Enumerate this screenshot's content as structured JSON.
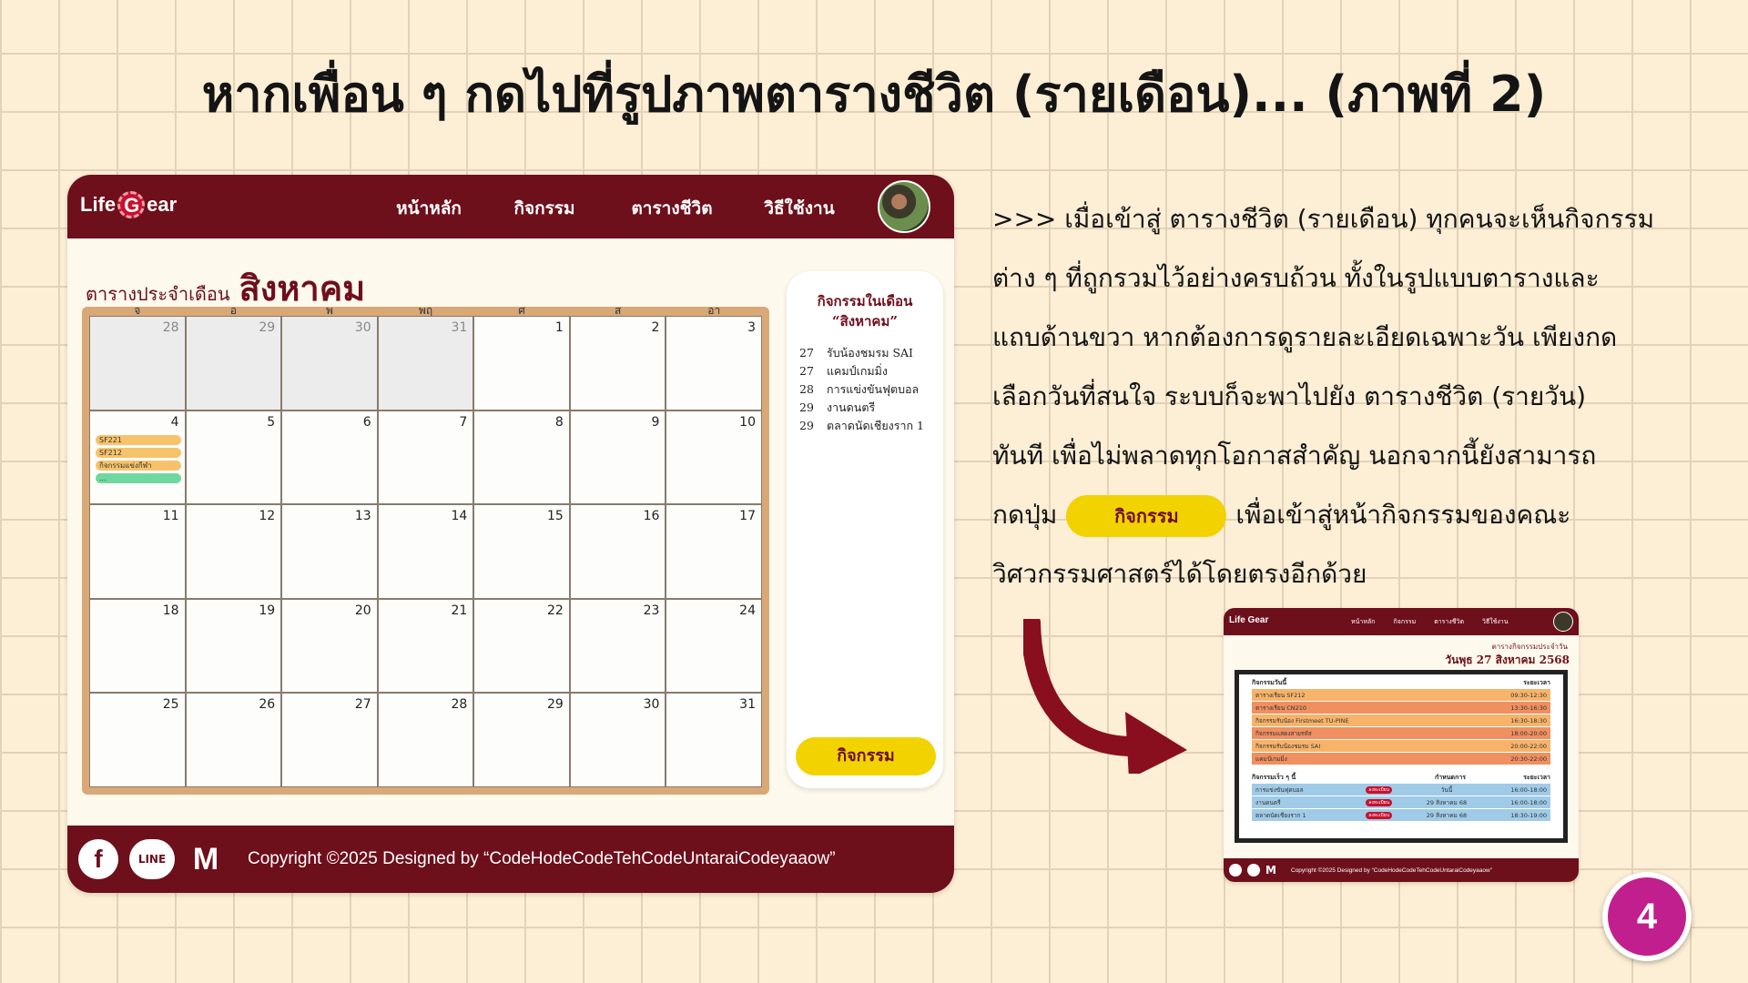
{
  "slide": {
    "title": "หากเพื่อน ๆ กดไปที่รูปภาพตารางชีวิต (รายเดือน)... (ภาพที่ 2)",
    "page_number": "4"
  },
  "site": {
    "logo_left": "Life",
    "logo_right": "ear",
    "logo_gear_letter": "G",
    "nav": [
      "หน้าหลัก",
      "กิจกรรม",
      "ตารางชีวิต",
      "วิธีใช้งาน"
    ]
  },
  "calendar": {
    "heading_prefix": "ตารางประจำเดือน",
    "month": "สิงหาคม",
    "weekdays": [
      "จ",
      "อ",
      "พ",
      "พฤ",
      "ศ",
      "ส",
      "อา"
    ],
    "weeks": [
      [
        {
          "d": "28",
          "other": true
        },
        {
          "d": "29",
          "other": true
        },
        {
          "d": "30",
          "other": true
        },
        {
          "d": "31",
          "other": true
        },
        {
          "d": "1"
        },
        {
          "d": "2"
        },
        {
          "d": "3"
        }
      ],
      [
        {
          "d": "4",
          "events": [
            {
              "label": "SF221",
              "color": "#f7c36a"
            },
            {
              "label": "SF212",
              "color": "#f7c36a"
            },
            {
              "label": "กิจกรรมแข่งกีฬา",
              "color": "#f7c36a"
            },
            {
              "label": "...",
              "color": "#6fd8a0"
            }
          ]
        },
        {
          "d": "5"
        },
        {
          "d": "6"
        },
        {
          "d": "7"
        },
        {
          "d": "8"
        },
        {
          "d": "9"
        },
        {
          "d": "10"
        }
      ],
      [
        {
          "d": "11"
        },
        {
          "d": "12"
        },
        {
          "d": "13"
        },
        {
          "d": "14"
        },
        {
          "d": "15"
        },
        {
          "d": "16"
        },
        {
          "d": "17"
        }
      ],
      [
        {
          "d": "18"
        },
        {
          "d": "19"
        },
        {
          "d": "20"
        },
        {
          "d": "21"
        },
        {
          "d": "22"
        },
        {
          "d": "23"
        },
        {
          "d": "24"
        }
      ],
      [
        {
          "d": "25"
        },
        {
          "d": "26"
        },
        {
          "d": "27"
        },
        {
          "d": "28"
        },
        {
          "d": "29"
        },
        {
          "d": "30"
        },
        {
          "d": "31"
        }
      ]
    ]
  },
  "side_panel": {
    "title_line1": "กิจกรรมในเดือน",
    "title_line2": "“สิงหาคม”",
    "items": [
      {
        "day": "27",
        "label": "รับน้องชมรม SAI"
      },
      {
        "day": "27",
        "label": "แคมป์เกมมิ่ง"
      },
      {
        "day": "28",
        "label": "การแข่งขันฟุตบอล"
      },
      {
        "day": "29",
        "label": "งานดนตรี"
      },
      {
        "day": "29",
        "label": "ตลาดนัดเชียงราก 1"
      }
    ],
    "button_label": "กิจกรรม"
  },
  "footer": {
    "icons": [
      "facebook-icon",
      "line-icon",
      "gmail-icon"
    ],
    "line_text": "LINE",
    "copyright": "Copyright  ©2025  Designed by “CodeHodeCodeTehCodeUntaraiCodeyaaow”"
  },
  "description": {
    "lines": [
      ">>> เมื่อเข้าสู่ ตารางชีวิต (รายเดือน) ทุกคนจะเห็นกิจกรรม",
      "ต่าง ๆ ที่ถูกรวมไว้อย่างครบถ้วน ทั้งในรูปแบบตารางและ",
      "แถบด้านขวา หากต้องการดูรายละเอียดเฉพาะวัน เพียงกด",
      "เลือกวันที่สนใจ ระบบก็จะพาไปยัง ตารางชีวิต (รายวัน)",
      "ทันที เพื่อไม่พลาดทุกโอกาสสำคัญ นอกจากนี้ยังสามารถ"
    ],
    "line6_before": "กดปุ่ม",
    "inline_button": "กิจกรรม",
    "line6_after": "เพื่อเข้าสู่หน้ากิจกรรมของคณะ",
    "line7": "วิศวกรรมศาสตร์ได้โดยตรงอีกด้วย"
  },
  "thumbnail": {
    "logo": "Life Gear",
    "nav": [
      "หน้าหลัก",
      "กิจกรรม",
      "ตารางชีวิต",
      "วิธีใช้งาน"
    ],
    "subheading": "ตารางกิจกรรมประจำวัน",
    "date": "วันพุธ 27 สิงหาคม 2568",
    "today_header": "กิจกรรมวันนี้",
    "time_header": "ระยะเวลา",
    "today_rows": [
      {
        "label": "ตารางเรียน SF212",
        "time": "09:30-12:30",
        "color": "orange"
      },
      {
        "label": "ตารางเรียน CN210",
        "time": "13:30-16:30",
        "color": "salmon"
      },
      {
        "label": "กิจกรรมรับน้อง Firstmeet TU-PINE",
        "time": "16:30-18:30",
        "color": "orange"
      },
      {
        "label": "กิจกรรมแสดงสายรหัส",
        "time": "18:00-20:00",
        "color": "salmon"
      },
      {
        "label": "กิจกรรมรับน้องชมรม SAI",
        "time": "20:00-22:00",
        "color": "orange"
      },
      {
        "label": "แคมป์เกมมิ่ง",
        "time": "20:30-22:00",
        "color": "salmon"
      }
    ],
    "soon_header": "กิจกรรมเร็ว ๆ นี้",
    "due_header": "กำหนดการ",
    "soon_rows": [
      {
        "label": "การแข่งขันฟุตบอล",
        "badge": "ลงทะเบียน",
        "due": "วันนี้",
        "time": "16:00-18:00"
      },
      {
        "label": "งานดนตรี",
        "badge": "ลงทะเบียน",
        "due": "29 สิงหาคม 68",
        "time": "16:00-18:00"
      },
      {
        "label": "ตลาดนัดเชียงราก 1",
        "badge": "ลงทะเบียน",
        "due": "29 สิงหาคม 68",
        "time": "18:30-19:00"
      }
    ],
    "copyright": "Copyright  ©2025  Designed by “CodeHodeCodeTehCodeUntaraiCodeyaaow”"
  },
  "colors": {
    "brand": "#6e0f1c",
    "accent_yellow": "#f2d200",
    "page_badge": "#c21f8e"
  }
}
